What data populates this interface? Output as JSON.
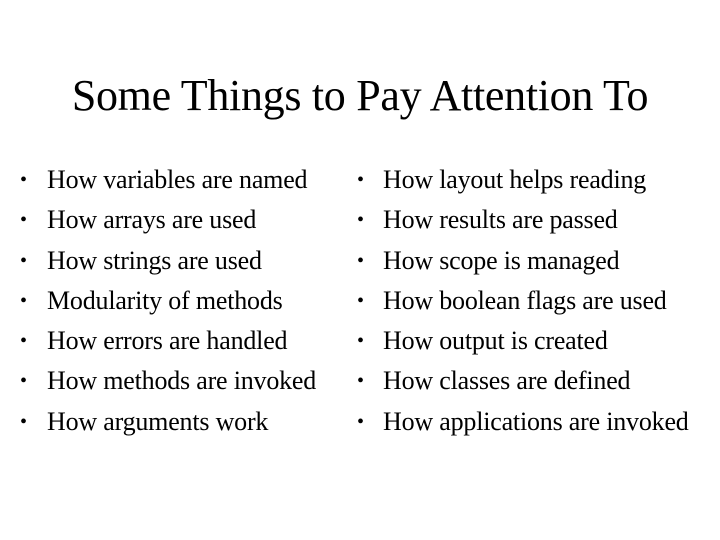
{
  "slide": {
    "title": "Some Things to Pay Attention To",
    "bullet_glyph": "•",
    "left_column": [
      {
        "text": "How variables are named"
      },
      {
        "text": "How arrays are used"
      },
      {
        "text": "How strings are used"
      },
      {
        "text": "Modularity of methods"
      },
      {
        "text": "How errors are handled"
      },
      {
        "text": "How methods are invoked"
      },
      {
        "text": "How arguments work"
      }
    ],
    "right_column": [
      {
        "text": "How layout helps reading"
      },
      {
        "text": "How results are passed"
      },
      {
        "text": "How scope is managed"
      },
      {
        "text": "How boolean flags are used"
      },
      {
        "text": "How output is created"
      },
      {
        "text": "How classes are defined"
      },
      {
        "text": "How applications are invoked"
      }
    ]
  }
}
